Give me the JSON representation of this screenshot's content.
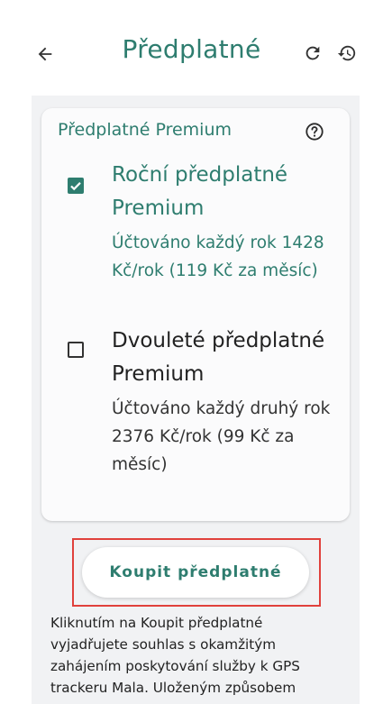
{
  "header": {
    "title": "Předplatné",
    "back_icon": "arrow-left-icon",
    "refresh_icon": "refresh-icon",
    "history_icon": "history-icon"
  },
  "card": {
    "title": "Předplatné Premium",
    "help_icon": "help-circle-icon",
    "options": [
      {
        "name": "Roční předplatné Premium",
        "description": "Účtováno každý rok 1428 Kč/rok (119 Kč za měsíc)",
        "checked": true
      },
      {
        "name": "Dvouleté předplatné Premium",
        "description": "Účtováno každý druhý rok 2376 Kč/rok (99 Kč za měsíc)",
        "checked": false
      }
    ]
  },
  "buy_button": {
    "label": "Koupit předplatné"
  },
  "legal_text": "Kliknutím na Koupit předplatné vyjadřujete souhlas s okamžitým zahájením poskytování služby k GPS trackeru Mala. Uloženým způsobem",
  "colors": {
    "accent": "#2e7d6f",
    "panel_bg": "#f1f2f4",
    "highlight_border": "#e0413c"
  }
}
